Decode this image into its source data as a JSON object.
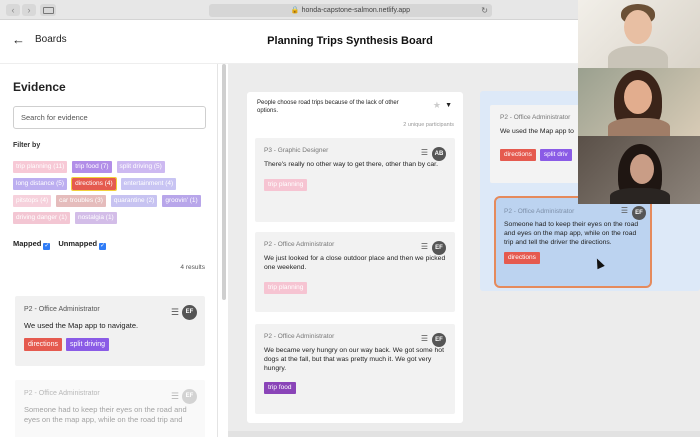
{
  "browser": {
    "url": "honda-capstone-salmon.netlify.app",
    "back_glyph": "‹",
    "forward_glyph": "›",
    "lock_glyph": "🔒",
    "reload_glyph": "↻"
  },
  "header": {
    "back_label": "Boards",
    "back_glyph": "←",
    "title": "Planning Trips Synthesis Board"
  },
  "sidebar": {
    "title": "Evidence",
    "search_placeholder": "Search for evidence",
    "filter_label": "Filter by",
    "tags": [
      {
        "label": "trip planning (11)",
        "bg": "#f7c9d6",
        "fg": "#ffffff",
        "border": ""
      },
      {
        "label": "trip food (7)",
        "bg": "#b28ee8",
        "fg": "#ffffff",
        "border": ""
      },
      {
        "label": "split driving (5)",
        "bg": "#cdb9f1",
        "fg": "#ffffff",
        "border": ""
      },
      {
        "label": "long distance (5)",
        "bg": "#bcaef0",
        "fg": "#ffffff",
        "border": ""
      },
      {
        "label": "directions (4)",
        "bg": "#e55a4f",
        "fg": "#ffffff",
        "border": "#f2d03a"
      },
      {
        "label": "entertainment (4)",
        "bg": "#c8c4f3",
        "fg": "#ffffff",
        "border": ""
      },
      {
        "label": "pitstops (4)",
        "bg": "#f6d1dc",
        "fg": "#ffffff",
        "border": ""
      },
      {
        "label": "car troubles (3)",
        "bg": "#e5bcbc",
        "fg": "#ffffff",
        "border": ""
      },
      {
        "label": "quarantine (2)",
        "bg": "#c7c3f1",
        "fg": "#ffffff",
        "border": ""
      },
      {
        "label": "groovin' (1)",
        "bg": "#b8a6ea",
        "fg": "#ffffff",
        "border": ""
      },
      {
        "label": "driving danger (1)",
        "bg": "#f3c6d3",
        "fg": "#ffffff",
        "border": ""
      },
      {
        "label": "nostalgia (1)",
        "bg": "#d3bde8",
        "fg": "#ffffff",
        "border": ""
      }
    ],
    "mapped_label": "Mapped",
    "unmapped_label": "Unmapped",
    "check_glyph": "✓",
    "results": "4 results",
    "cards": [
      {
        "who": "P2 - Office Administrator",
        "initials": "EF",
        "quote": "We used the Map app to navigate.",
        "tags": [
          {
            "label": "directions",
            "bg": "#e55a4f"
          },
          {
            "label": "split driving",
            "bg": "#8a5be6"
          }
        ]
      },
      {
        "who": "P2 - Office Administrator",
        "initials": "EF",
        "quote": "Someone had to keep their eyes on the road and eyes on the map app, while on the road trip and",
        "tags": []
      }
    ],
    "menu_glyph": "☰"
  },
  "board": {
    "column1": {
      "title": "People choose road trips because of the lack of other options.",
      "count": "2 unique participants",
      "star_glyph": "★",
      "caret_glyph": "▼",
      "notes": [
        {
          "who": "P3 - Graphic Designer",
          "initials": "AB",
          "quote": "There's really no other way to get there, other than by car.",
          "tag": "trip planning",
          "tag_bg": "#f6c4d2"
        },
        {
          "who": "P2 - Office Administrator",
          "initials": "EF",
          "quote": "We just looked for a close outdoor place and then we picked one weekend.",
          "tag": "trip planning",
          "tag_bg": "#f6c4d2"
        },
        {
          "who": "P2 - Office Administrator",
          "initials": "EF",
          "quote": "We became very hungry on our way back. We got some hot dogs at the fall, but that was pretty much it. We got very hungry.",
          "tag": "trip food",
          "tag_bg": "#8a44b8"
        }
      ]
    },
    "column2": {
      "note": {
        "who": "P2 - Office Administrator",
        "quote": "We used the Map app to",
        "tags": [
          {
            "label": "directions",
            "bg": "#e55a4f"
          },
          {
            "label": "split driv",
            "bg": "#8a5be6"
          }
        ]
      }
    },
    "dragging": {
      "who": "P2 - Office Administrator",
      "initials": "EF",
      "quote": "Someone had to keep their eyes on the road and eyes on the map app, while on the road trip and tell the driver the directions.",
      "tag": "directions"
    }
  },
  "colors": {
    "accent_blue": "#2f7cf6",
    "drag_border": "#e58a5c",
    "board_bg": "#ececec"
  }
}
